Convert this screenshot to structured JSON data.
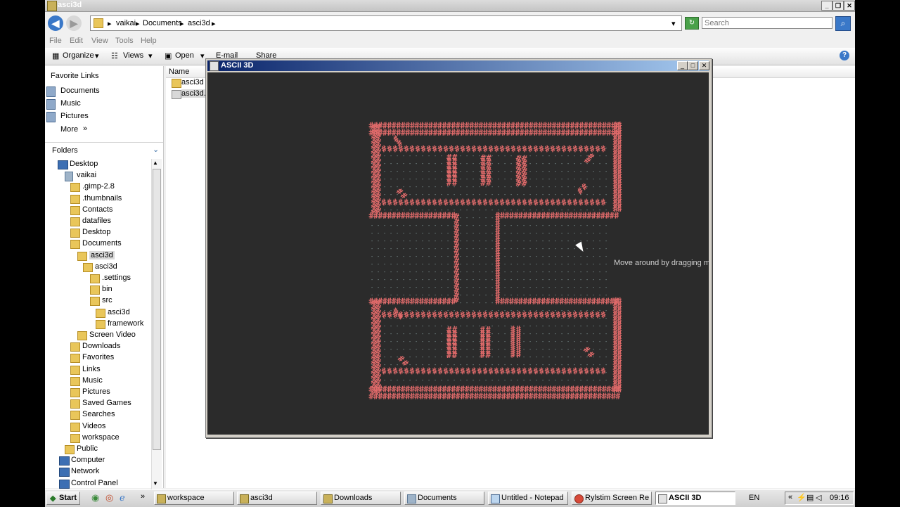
{
  "explorer": {
    "title": "asci3d",
    "breadcrumbs": [
      "vaikai",
      "Documents",
      "asci3d"
    ],
    "search_placeholder": "Search",
    "menu": [
      "File",
      "Edit",
      "View",
      "Tools",
      "Help"
    ],
    "commands": {
      "organize": "Organize",
      "views": "Views",
      "open": "Open",
      "email": "E-mail",
      "share": "Share"
    },
    "favorite_links_header": "Favorite Links",
    "favorites": [
      "Documents",
      "Music",
      "Pictures"
    ],
    "more": "More",
    "folders_header": "Folders",
    "tree": [
      {
        "label": "Desktop",
        "icon": "desktop-icon"
      },
      {
        "label": "vaikai",
        "icon": "user-icon"
      },
      {
        "label": ".gimp-2.8",
        "icon": "folder-icon"
      },
      {
        "label": ".thumbnails",
        "icon": "folder-icon"
      },
      {
        "label": "Contacts",
        "icon": "folder-icon"
      },
      {
        "label": "datafiles",
        "icon": "folder-icon"
      },
      {
        "label": "Desktop",
        "icon": "folder-icon"
      },
      {
        "label": "Documents",
        "icon": "folder-icon"
      },
      {
        "label": "asci3d",
        "icon": "folder-icon"
      },
      {
        "label": "asci3d",
        "icon": "folder-icon"
      },
      {
        "label": ".settings",
        "icon": "folder-icon"
      },
      {
        "label": "bin",
        "icon": "folder-icon"
      },
      {
        "label": "src",
        "icon": "folder-icon"
      },
      {
        "label": "asci3d",
        "icon": "folder-icon"
      },
      {
        "label": "framework",
        "icon": "folder-icon"
      },
      {
        "label": "Screen Video",
        "icon": "folder-icon"
      },
      {
        "label": "Downloads",
        "icon": "folder-icon"
      },
      {
        "label": "Favorites",
        "icon": "folder-icon"
      },
      {
        "label": "Links",
        "icon": "folder-icon"
      },
      {
        "label": "Music",
        "icon": "folder-icon"
      },
      {
        "label": "Pictures",
        "icon": "folder-icon"
      },
      {
        "label": "Saved Games",
        "icon": "folder-icon"
      },
      {
        "label": "Searches",
        "icon": "folder-icon"
      },
      {
        "label": "Videos",
        "icon": "folder-icon"
      },
      {
        "label": "workspace",
        "icon": "folder-icon"
      },
      {
        "label": "Public",
        "icon": "folder-icon"
      },
      {
        "label": "Computer",
        "icon": "computer-icon"
      },
      {
        "label": "Network",
        "icon": "network-icon"
      },
      {
        "label": "Control Panel",
        "icon": "control-panel-icon"
      }
    ],
    "column_name": "Name",
    "files": [
      "asci3d",
      "asci3d."
    ]
  },
  "ascii3d": {
    "title": "ASCII 3D",
    "hint": "Move around by dragging m",
    "glyph": "#",
    "glyph_color": "#e06a6a",
    "grid_glyph": "-",
    "grid_color": "#8aa0a0"
  },
  "taskbar": {
    "start": "Start",
    "buttons": [
      "workspace",
      "asci3d",
      "Downloads",
      "Documents",
      "Untitled - Notepad",
      "Rylstim Screen Re...",
      "ASCII 3D"
    ],
    "active": "ASCII 3D",
    "lang": "EN",
    "clock": "09:16"
  }
}
